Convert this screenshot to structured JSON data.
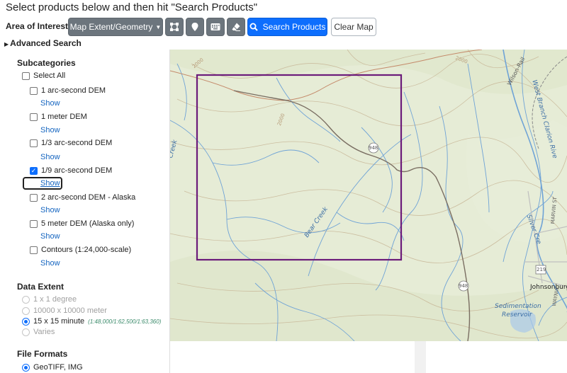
{
  "heading": "Select products below and then hit \"Search Products\"",
  "area_of_interest": {
    "label": "Area of Interest:",
    "dropdown_label": "Map Extent/Geometry",
    "search_button": "Search Products",
    "clear_button": "Clear Map"
  },
  "advanced_search": "Advanced Search",
  "subcategories": {
    "title": "Subcategories",
    "select_all": "Select All",
    "show_label": "Show",
    "items": [
      {
        "label": "1 arc-second DEM",
        "checked": false
      },
      {
        "label": "1 meter DEM",
        "checked": false
      },
      {
        "label": "1/3 arc-second DEM",
        "checked": false
      },
      {
        "label": "1/9 arc-second DEM",
        "checked": true
      },
      {
        "label": "2 arc-second DEM - Alaska",
        "checked": false
      },
      {
        "label": "5 meter DEM (Alaska only)",
        "checked": false
      },
      {
        "label": "Contours (1:24,000-scale)",
        "checked": false
      }
    ]
  },
  "data_extent": {
    "title": "Data Extent",
    "options": [
      {
        "label": "1 x 1 degree",
        "selected": false,
        "disabled": true
      },
      {
        "label": "10000 x 10000 meter",
        "selected": false,
        "disabled": true
      },
      {
        "label": "15 x 15 minute",
        "selected": true,
        "disabled": false,
        "note": "(1:48,000/1:62,500/1:63,360)"
      },
      {
        "label": "Varies",
        "selected": false,
        "disabled": true
      }
    ]
  },
  "file_formats": {
    "title": "File Formats",
    "options": [
      {
        "label": "GeoTIFF, IMG",
        "selected": true
      }
    ]
  },
  "map": {
    "labels": {
      "contour_2000_a": "2000",
      "contour_2000_b": "2000",
      "contour_2000_c": "2000",
      "route_948_a": "948",
      "route_948_b": "948",
      "route_219": "219",
      "bear_creek": "Bear Creek",
      "wilson_rail": "Wilson-Rail",
      "west_branch": "West Branch Clarion Rive",
      "silver": "Silver Cre",
      "marvin": "MARVIN ST",
      "johnsonburg": "Johnsonburg",
      "sedimentation_1": "Sedimentation",
      "sedimentation_2": "Reservoir",
      "creek_left": "Creek",
      "waynw": "WAYNW"
    },
    "colors": {
      "background": "#e6ecd6",
      "water": "#6fa3d6",
      "road_major": "#7a6e62",
      "road_minor": "#c48a6a",
      "contour": "#c9b99a",
      "selection": "#6b1b7a"
    }
  }
}
